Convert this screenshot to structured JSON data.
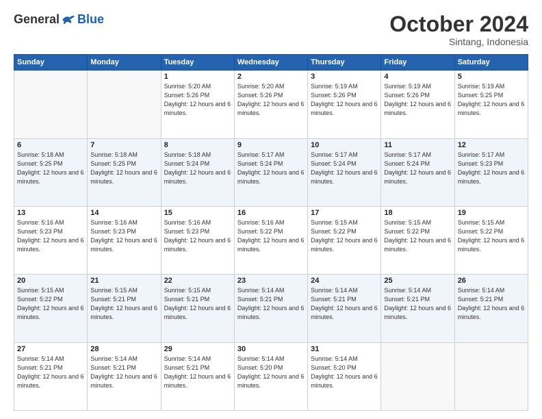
{
  "header": {
    "logo_general": "General",
    "logo_blue": "Blue",
    "month": "October 2024",
    "location": "Sintang, Indonesia"
  },
  "days_of_week": [
    "Sunday",
    "Monday",
    "Tuesday",
    "Wednesday",
    "Thursday",
    "Friday",
    "Saturday"
  ],
  "weeks": [
    [
      {
        "day": "",
        "info": ""
      },
      {
        "day": "",
        "info": ""
      },
      {
        "day": "1",
        "sunrise": "5:20 AM",
        "sunset": "5:26 PM",
        "daylight": "12 hours and 6 minutes."
      },
      {
        "day": "2",
        "sunrise": "5:20 AM",
        "sunset": "5:26 PM",
        "daylight": "12 hours and 6 minutes."
      },
      {
        "day": "3",
        "sunrise": "5:19 AM",
        "sunset": "5:26 PM",
        "daylight": "12 hours and 6 minutes."
      },
      {
        "day": "4",
        "sunrise": "5:19 AM",
        "sunset": "5:26 PM",
        "daylight": "12 hours and 6 minutes."
      },
      {
        "day": "5",
        "sunrise": "5:19 AM",
        "sunset": "5:25 PM",
        "daylight": "12 hours and 6 minutes."
      }
    ],
    [
      {
        "day": "6",
        "sunrise": "5:18 AM",
        "sunset": "5:25 PM",
        "daylight": "12 hours and 6 minutes."
      },
      {
        "day": "7",
        "sunrise": "5:18 AM",
        "sunset": "5:25 PM",
        "daylight": "12 hours and 6 minutes."
      },
      {
        "day": "8",
        "sunrise": "5:18 AM",
        "sunset": "5:24 PM",
        "daylight": "12 hours and 6 minutes."
      },
      {
        "day": "9",
        "sunrise": "5:17 AM",
        "sunset": "5:24 PM",
        "daylight": "12 hours and 6 minutes."
      },
      {
        "day": "10",
        "sunrise": "5:17 AM",
        "sunset": "5:24 PM",
        "daylight": "12 hours and 6 minutes."
      },
      {
        "day": "11",
        "sunrise": "5:17 AM",
        "sunset": "5:24 PM",
        "daylight": "12 hours and 6 minutes."
      },
      {
        "day": "12",
        "sunrise": "5:17 AM",
        "sunset": "5:23 PM",
        "daylight": "12 hours and 6 minutes."
      }
    ],
    [
      {
        "day": "13",
        "sunrise": "5:16 AM",
        "sunset": "5:23 PM",
        "daylight": "12 hours and 6 minutes."
      },
      {
        "day": "14",
        "sunrise": "5:16 AM",
        "sunset": "5:23 PM",
        "daylight": "12 hours and 6 minutes."
      },
      {
        "day": "15",
        "sunrise": "5:16 AM",
        "sunset": "5:23 PM",
        "daylight": "12 hours and 6 minutes."
      },
      {
        "day": "16",
        "sunrise": "5:16 AM",
        "sunset": "5:22 PM",
        "daylight": "12 hours and 6 minutes."
      },
      {
        "day": "17",
        "sunrise": "5:15 AM",
        "sunset": "5:22 PM",
        "daylight": "12 hours and 6 minutes."
      },
      {
        "day": "18",
        "sunrise": "5:15 AM",
        "sunset": "5:22 PM",
        "daylight": "12 hours and 6 minutes."
      },
      {
        "day": "19",
        "sunrise": "5:15 AM",
        "sunset": "5:22 PM",
        "daylight": "12 hours and 6 minutes."
      }
    ],
    [
      {
        "day": "20",
        "sunrise": "5:15 AM",
        "sunset": "5:22 PM",
        "daylight": "12 hours and 6 minutes."
      },
      {
        "day": "21",
        "sunrise": "5:15 AM",
        "sunset": "5:21 PM",
        "daylight": "12 hours and 6 minutes."
      },
      {
        "day": "22",
        "sunrise": "5:15 AM",
        "sunset": "5:21 PM",
        "daylight": "12 hours and 6 minutes."
      },
      {
        "day": "23",
        "sunrise": "5:14 AM",
        "sunset": "5:21 PM",
        "daylight": "12 hours and 6 minutes."
      },
      {
        "day": "24",
        "sunrise": "5:14 AM",
        "sunset": "5:21 PM",
        "daylight": "12 hours and 6 minutes."
      },
      {
        "day": "25",
        "sunrise": "5:14 AM",
        "sunset": "5:21 PM",
        "daylight": "12 hours and 6 minutes."
      },
      {
        "day": "26",
        "sunrise": "5:14 AM",
        "sunset": "5:21 PM",
        "daylight": "12 hours and 6 minutes."
      }
    ],
    [
      {
        "day": "27",
        "sunrise": "5:14 AM",
        "sunset": "5:21 PM",
        "daylight": "12 hours and 6 minutes."
      },
      {
        "day": "28",
        "sunrise": "5:14 AM",
        "sunset": "5:21 PM",
        "daylight": "12 hours and 6 minutes."
      },
      {
        "day": "29",
        "sunrise": "5:14 AM",
        "sunset": "5:21 PM",
        "daylight": "12 hours and 6 minutes."
      },
      {
        "day": "30",
        "sunrise": "5:14 AM",
        "sunset": "5:20 PM",
        "daylight": "12 hours and 6 minutes."
      },
      {
        "day": "31",
        "sunrise": "5:14 AM",
        "sunset": "5:20 PM",
        "daylight": "12 hours and 6 minutes."
      },
      {
        "day": "",
        "info": ""
      },
      {
        "day": "",
        "info": ""
      }
    ]
  ]
}
